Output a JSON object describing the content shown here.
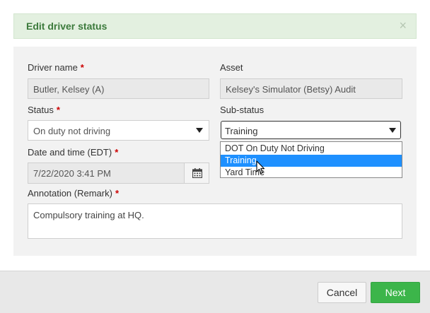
{
  "header": {
    "title": "Edit driver status",
    "close_glyph": "×"
  },
  "form": {
    "driver_name": {
      "label": "Driver name",
      "required": "*",
      "value": "Butler, Kelsey (A)"
    },
    "asset": {
      "label": "Asset",
      "value": "Kelsey's Simulator (Betsy) Audit"
    },
    "status": {
      "label": "Status",
      "required": "*",
      "value": "On duty not driving"
    },
    "substatus": {
      "label": "Sub-status",
      "value": "Training",
      "options": [
        "DOT On Duty Not Driving",
        "Training",
        "Yard Time"
      ],
      "highlighted_index": 1
    },
    "datetime": {
      "label": "Date and time (EDT)",
      "required": "*",
      "value": "7/22/2020 3:41 PM"
    },
    "annotation": {
      "label": "Annotation (Remark)",
      "required": "*",
      "value": "Compulsory training at HQ."
    }
  },
  "footer": {
    "cancel_label": "Cancel",
    "next_label": "Next"
  },
  "colors": {
    "header_bg": "#e3f0e0",
    "header_text": "#3c7a3c",
    "next_button": "#3cb54a",
    "highlight": "#1e90ff",
    "required": "#cc0000"
  },
  "icons": {
    "close": "close-icon",
    "calendar": "calendar-icon",
    "dropdown": "chevron-down-icon",
    "cursor": "mouse-pointer-icon"
  }
}
